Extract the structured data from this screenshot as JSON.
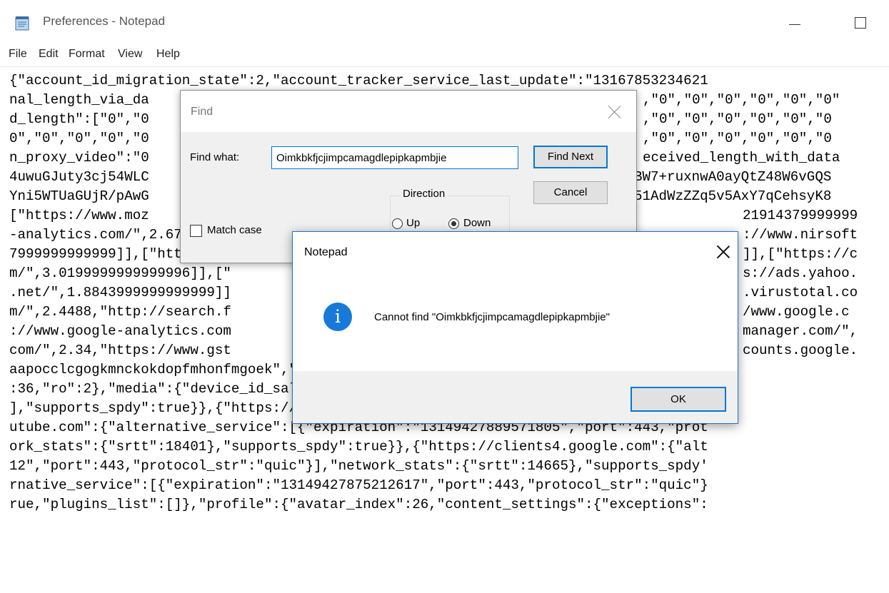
{
  "window": {
    "title": "Preferences - Notepad",
    "icon": "notepad-icon",
    "controls": [
      "minimize-icon",
      "maximize-icon"
    ]
  },
  "menu": [
    "File",
    "Edit",
    "Format",
    "View",
    "Help"
  ],
  "editor": {
    "lines": [
      "{\"account_id_migration_state\":2,\"account_tracker_service_last_update\":\"13167853234621",
      "nal_length_via_da",
      "d_length\":[\"0\",\"0",
      "0\",\"0\",\"0\",\"0\",\"0",
      "n_proxy_video\":\"0",
      "4uwuGJuty3cj54WLC",
      "Yni5WTUaGUjR/pAwG",
      "[\"https://www.moz",
      "-analytics.com/\",2.67999999",
      "7999999999999]],[\"https://d",
      "m/\",3.0199999999999996]],[\"",
      ".net/\",1.8843999999999999]]",
      "m/\",2.4488,\"http://search.f",
      "://www.google-analytics.com",
      "com/\",2.34,\"https://www.gst",
      "aapocclcgogkmnckokdopfmhonfmgoek\",\"aohghmighlieiainnegkcijnfilokake\",\"felcaaldnbdnccl",
      ":36,\"ro\":2},\"media\":{\"device_id_salt\":\"+yt/+0qYTWVCi6sALKTrIQ==\",\"engagement\":{\"schem",
      "],\"supports_spdy\":true}},{\"https://www.googleapis.com\":{\"alternative_service\":[{\"expi",
      "utube.com\":{\"alternative_service\":[{\"expiration\":\"13149427889571805\",\"port\":443,\"prot",
      "ork_stats\":{\"srtt\":18401},\"supports_spdy\":true}},{\"https://clients4.google.com\":{\"alt",
      "12\",\"port\":443,\"protocol_str\":\"quic\"}],\"network_stats\":{\"srtt\":14665},\"supports_spdy'",
      "rnative_service\":[{\"expiration\":\"13149427875212617\",\"port\":443,\"protocol_str\":\"quic\"}",
      "rue,\"plugins_list\":[]},\"profile\":{\"avatar_index\":26,\"content_settings\":{\"exceptions\":"
    ],
    "right_fragments": [
      ",\"0\",\"0\",\"0\",\"0\",\"0\",\"0\"",
      ",\"0\",\"0\",\"0\",\"0\",\"0\",\"0",
      ",\"0\",\"0\",\"0\",\"0\",\"0\",\"0",
      "eceived_length_with_data",
      "BW7+ruxnwA0ayQtZ48W6vGQS",
      "51AdWzZZq5v5AxY7qCehsyK8",
      "21914379999999",
      "://www.nirsoft",
      "]],[\"https://c",
      "s://ads.yahoo.",
      ".virustotal.co",
      "/www.google.c",
      "manager.com/\",",
      "counts.google."
    ]
  },
  "find_dialog": {
    "title": "Find",
    "find_what_label": "Find what:",
    "find_what_value": "Oimkbkfjcjimpcamagdlepipkapmbjie",
    "find_next_label": "Find Next",
    "cancel_label": "Cancel",
    "direction_label": "Direction",
    "up_label": "Up",
    "down_label": "Down",
    "direction_selected": "Down",
    "match_case_label": "Match case",
    "match_case_checked": false
  },
  "message_box": {
    "title": "Notepad",
    "icon": "info-icon",
    "icon_glyph": "i",
    "message": "Cannot find \"Oimkbkfjcjimpcamagdlepipkapmbjie\"",
    "ok_label": "OK"
  },
  "colors": {
    "accent": "#0078d7",
    "info_icon": "#1879d8",
    "dialog_bg": "#f0f0f0"
  }
}
